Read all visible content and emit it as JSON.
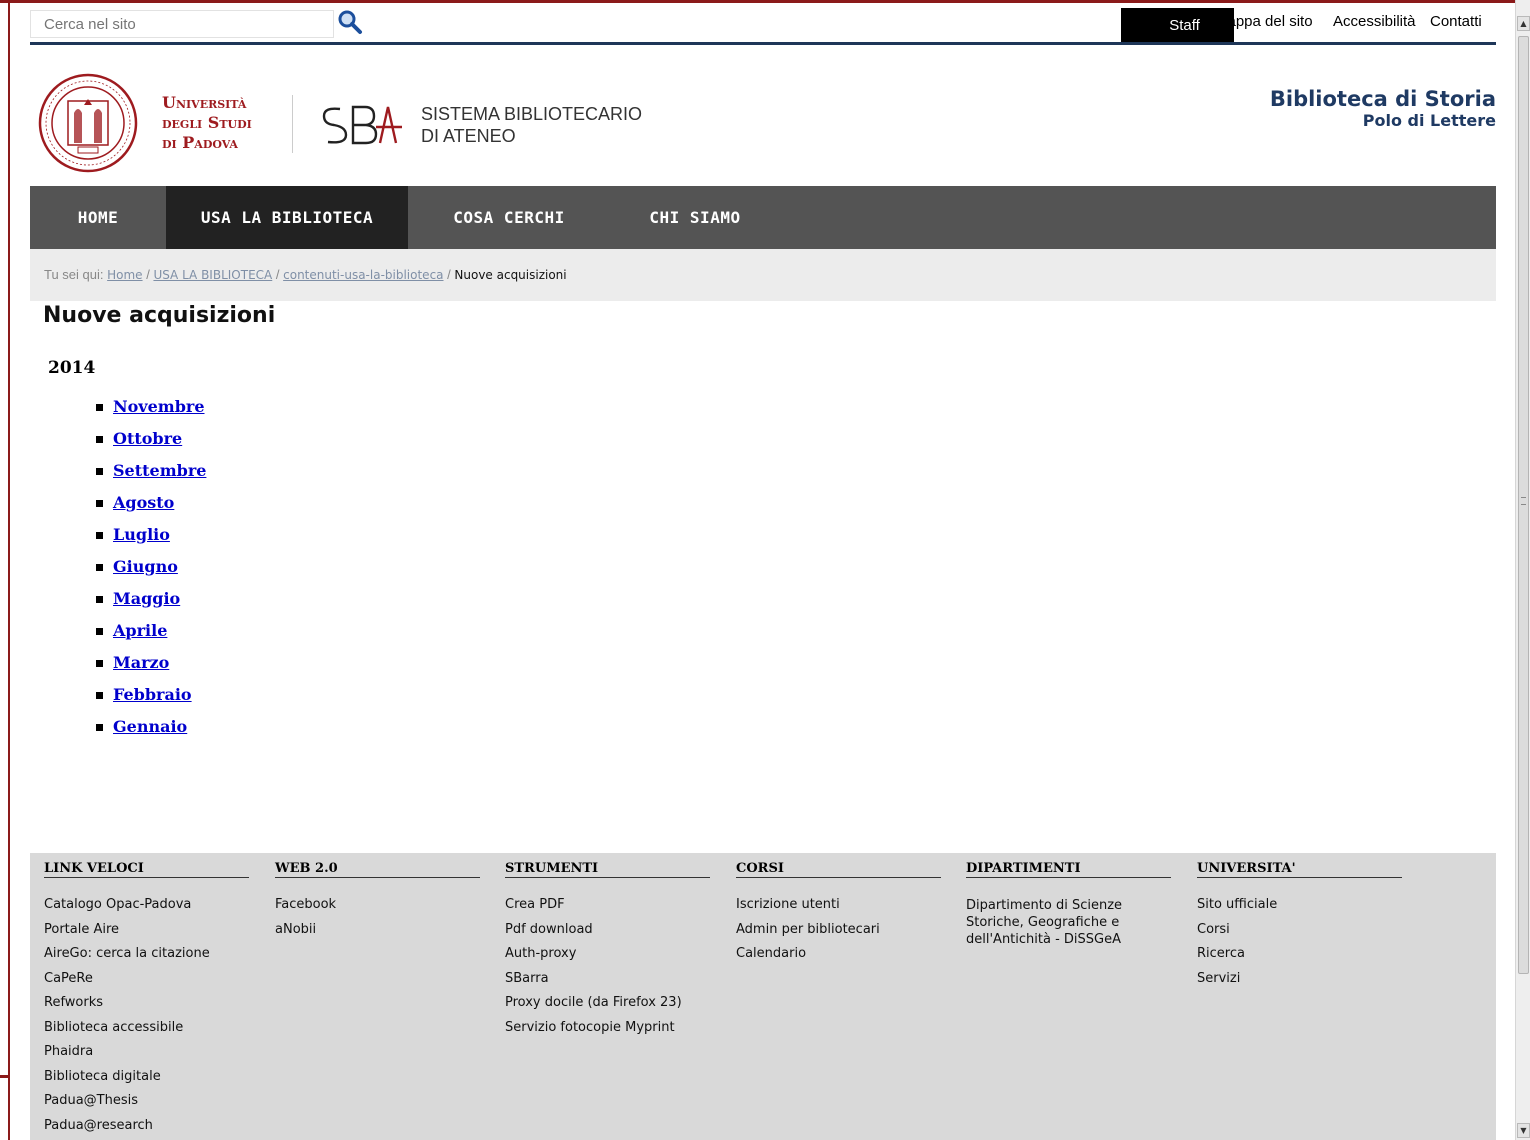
{
  "search": {
    "placeholder": "Cerca nel sito"
  },
  "utility": {
    "staff": "Staff",
    "links": [
      "Mappa del sito",
      "Accessibilità",
      "Contatti"
    ]
  },
  "header": {
    "university": [
      "Università",
      "degli Studi",
      "di Padova"
    ],
    "sba_line1": "SISTEMA BIBLIOTECARIO",
    "sba_line2": "DI ATENEO",
    "library_title": "Biblioteca di Storia",
    "library_subtitle": "Polo di Lettere"
  },
  "nav": [
    "HOME",
    "USA LA BIBLIOTECA",
    "COSA CERCHI",
    "CHI SIAMO"
  ],
  "breadcrumb": {
    "prefix": "Tu sei qui:",
    "links": [
      "Home",
      "USA LA BIBLIOTECA",
      "contenuti-usa-la-biblioteca"
    ],
    "current": "Nuove acquisizioni"
  },
  "page": {
    "title": "Nuove acquisizioni",
    "year": "2014",
    "months": [
      "Novembre",
      "Ottobre",
      "Settembre",
      "Agosto",
      "Luglio",
      "Giugno",
      "Maggio",
      "Aprile",
      "Marzo",
      "Febbraio",
      "Gennaio"
    ]
  },
  "footer": {
    "columns": [
      {
        "title": "LINK VELOCI",
        "items": [
          "Catalogo Opac-Padova",
          "Portale Aire",
          "AireGo: cerca la citazione",
          "CaPeRe",
          "Refworks",
          "Biblioteca accessibile",
          "Phaidra",
          "Biblioteca digitale",
          "Padua@Thesis",
          "Padua@research"
        ]
      },
      {
        "title": "WEB 2.0",
        "items": [
          "Facebook",
          "aNobii"
        ]
      },
      {
        "title": "STRUMENTI",
        "items": [
          "Crea PDF",
          "Pdf download",
          "Auth-proxy",
          "SBarra",
          "Proxy docile (da Firefox 23)",
          "Servizio fotocopie Myprint"
        ]
      },
      {
        "title": "CORSI",
        "items": [
          "Iscrizione utenti",
          "Admin per bibliotecari",
          "Calendario"
        ]
      },
      {
        "title": "DIPARTIMENTI",
        "items": [
          "Dipartimento di Scienze Storiche, Geografiche e dell'Antichità - DiSSGeA"
        ]
      },
      {
        "title": "UNIVERSITA'",
        "items": [
          "Sito ufficiale",
          "Corsi",
          "Ricerca",
          "Servizi"
        ]
      }
    ]
  },
  "colors": {
    "brand_red": "#9e1b1f",
    "navy": "#1f3a63",
    "nav_bg": "#545454",
    "nav_active": "#222222",
    "link": "#0000cc"
  }
}
